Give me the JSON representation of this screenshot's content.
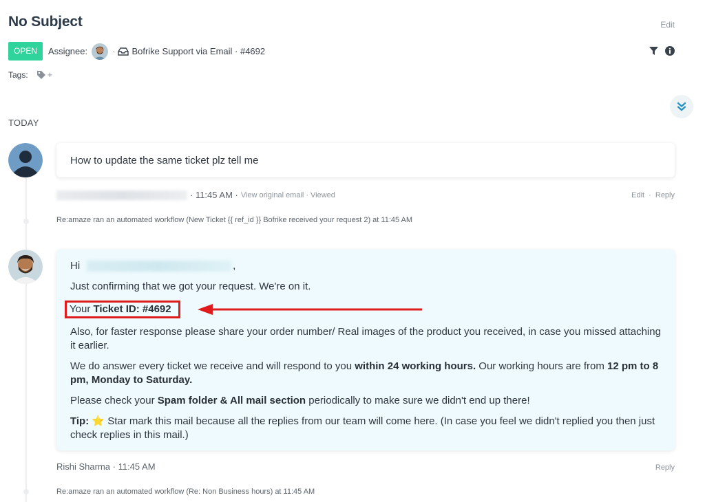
{
  "ticket": {
    "title": "No Subject",
    "edit_label": "Edit",
    "status": "OPEN",
    "assignee_label": "Assignee:",
    "separator": "·",
    "channel": "Bofrike Support via Email · #4692",
    "tags_label": "Tags:",
    "tags_add": "+"
  },
  "timeline": {
    "day_label": "TODAY"
  },
  "message1": {
    "body": "How to update the same ticket plz tell me",
    "time": "· 11:45 AM ·",
    "view_original": "View original email",
    "dot": "·",
    "viewed": "Viewed",
    "edit": "Edit",
    "reply": "Reply",
    "sep": "·"
  },
  "workflow1": {
    "text": "Re:amaze ran an automated workflow (New Ticket {{ ref_id }} Bofrike received your request 2) at 11:45 AM"
  },
  "message2": {
    "greeting": "Hi",
    "greeting_end": ",",
    "line1": "Just confirming that we got your request. We're on it.",
    "ticket_prefix": "Your",
    "ticket_id": "Ticket ID: #4692",
    "line3": "Also, for faster response please share your order number/ Real images of the product you received, in case you missed attaching it earlier.",
    "line4_a": "We do answer every ticket we receive and will respond to you ",
    "line4_b": "within 24 working hours.",
    "line4_c": " Our working hours are from ",
    "line4_d": "12 pm to 8 pm, Monday to Saturday.",
    "line5_a": "Please check your ",
    "line5_b": "Spam folder & All mail section",
    "line5_c": " periodically to make sure we didn't end up there!",
    "tip_label": "Tip:",
    "tip_star": "⭐",
    "tip_text": " Star mark this mail because all the replies from our team will come here. (In case you feel we didn't replied you then just check replies in this mail.)",
    "author_time": "Rishi Sharma · 11:45 AM",
    "reply": "Reply"
  },
  "workflow2": {
    "text": "Re:amaze ran an automated workflow (Re: Non Business hours) at 11:45 AM"
  },
  "colors": {
    "status_green": "#2fd39c",
    "annotation_red": "#e01b1b",
    "agent_bubble": "#eefafd"
  }
}
